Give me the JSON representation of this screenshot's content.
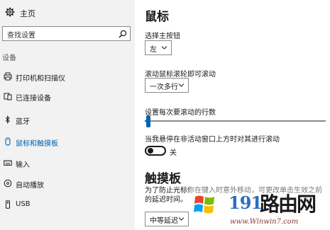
{
  "sidebar": {
    "home_label": "主页",
    "search_placeholder": "查找设置",
    "section_label": "设备",
    "items": [
      {
        "label": "打印机和扫描仪",
        "icon": "printer-icon",
        "active": false
      },
      {
        "label": "已连接设备",
        "icon": "connected-devices-icon",
        "active": false
      },
      {
        "label": "蓝牙",
        "icon": "bluetooth-icon",
        "active": false
      },
      {
        "label": "鼠标和触摸板",
        "icon": "mouse-icon",
        "active": true
      },
      {
        "label": "输入",
        "icon": "keyboard-icon",
        "active": false
      },
      {
        "label": "自动播放",
        "icon": "autoplay-icon",
        "active": false
      },
      {
        "label": "USB",
        "icon": "usb-icon",
        "active": false
      }
    ]
  },
  "main": {
    "title": "鼠标",
    "primary_button": {
      "label": "选择主按钮",
      "value": "左"
    },
    "scroll_mode": {
      "label": "滚动鼠标滚轮即可滚动",
      "value": "一次多行"
    },
    "scroll_lines": {
      "label": "设置每次要滚动的行数",
      "value": 3,
      "min": 1,
      "max": 100
    },
    "inactive_scroll": {
      "label": "当我悬停在非活动窗口上方时对其进行滚动",
      "state": "关",
      "on": false
    },
    "touchpad_title": "触摸板",
    "touchpad_desc": "为了防止光标你在键入时意外移动，可更改单击生效之前的延迟时间。",
    "touchpad_delay": {
      "value": "中等延迟"
    }
  },
  "watermark": {
    "number": "191",
    "text": "路由网",
    "url": "www.Winwin7.com"
  },
  "colors": {
    "accent": "#0063b1",
    "sidebar_bg": "#f2f2f2"
  }
}
